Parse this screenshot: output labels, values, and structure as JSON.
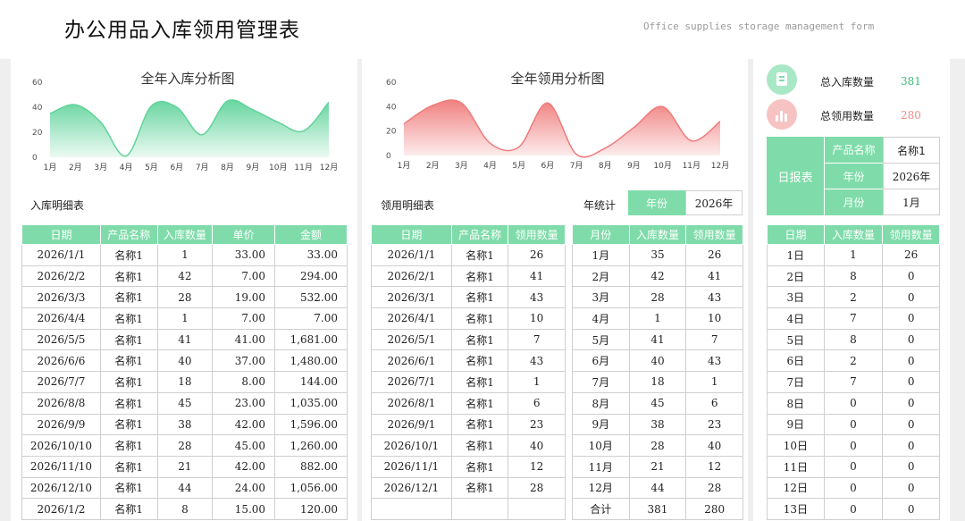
{
  "header": {
    "title": "办公用品入库领用管理表",
    "subtitle": "Office supplies storage management form"
  },
  "charts_labels": {
    "in_title": "全年入库分析图",
    "out_title": "全年领用分析图"
  },
  "chart_data": [
    {
      "type": "area",
      "title": "全年入库分析图",
      "categories": [
        "1月",
        "2月",
        "3月",
        "4月",
        "5月",
        "6月",
        "7月",
        "8月",
        "9月",
        "10月",
        "11月",
        "12月"
      ],
      "values": [
        35,
        42,
        28,
        1,
        41,
        40,
        18,
        45,
        38,
        28,
        21,
        44
      ],
      "ylim": [
        0,
        60
      ],
      "yticks": [
        0,
        20,
        40,
        60
      ],
      "color": "#5fd39a"
    },
    {
      "type": "area",
      "title": "全年领用分析图",
      "categories": [
        "1月",
        "2月",
        "3月",
        "4月",
        "5月",
        "6月",
        "7月",
        "8月",
        "9月",
        "10月",
        "11月",
        "12月"
      ],
      "values": [
        26,
        41,
        43,
        10,
        7,
        43,
        1,
        6,
        23,
        40,
        12,
        28
      ],
      "ylim": [
        0,
        60
      ],
      "yticks": [
        0,
        20,
        40,
        60
      ],
      "color": "#f07a7a"
    }
  ],
  "summary": {
    "in_label": "总入库数量",
    "in_value": "381",
    "out_label": "总领用数量",
    "out_value": "280"
  },
  "daily_report": {
    "label": "日报表",
    "rows": [
      {
        "k": "产品名称",
        "v": "名称1"
      },
      {
        "k": "年份",
        "v": "2026年"
      },
      {
        "k": "月份",
        "v": "1月"
      }
    ]
  },
  "year_stats": {
    "label": "年统计",
    "key": "年份",
    "value": "2026年"
  },
  "in_table": {
    "label": "入库明细表",
    "headers": [
      "日期",
      "产品名称",
      "入库数量",
      "单价",
      "金额"
    ],
    "rows": [
      [
        "2026/1/1",
        "名称1",
        "1",
        "33.00",
        "33.00"
      ],
      [
        "2026/2/2",
        "名称1",
        "42",
        "7.00",
        "294.00"
      ],
      [
        "2026/3/3",
        "名称1",
        "28",
        "19.00",
        "532.00"
      ],
      [
        "2026/4/4",
        "名称1",
        "1",
        "7.00",
        "7.00"
      ],
      [
        "2026/5/5",
        "名称1",
        "41",
        "41.00",
        "1,681.00"
      ],
      [
        "2026/6/6",
        "名称1",
        "40",
        "37.00",
        "1,480.00"
      ],
      [
        "2026/7/7",
        "名称1",
        "18",
        "8.00",
        "144.00"
      ],
      [
        "2026/8/8",
        "名称1",
        "45",
        "23.00",
        "1,035.00"
      ],
      [
        "2026/9/9",
        "名称1",
        "38",
        "42.00",
        "1,596.00"
      ],
      [
        "2026/10/10",
        "名称1",
        "28",
        "45.00",
        "1,260.00"
      ],
      [
        "2026/11/10",
        "名称1",
        "21",
        "42.00",
        "882.00"
      ],
      [
        "2026/12/10",
        "名称1",
        "44",
        "24.00",
        "1,056.00"
      ],
      [
        "2026/1/2",
        "名称1",
        "8",
        "15.00",
        "120.00"
      ]
    ]
  },
  "out_table": {
    "label": "领用明细表",
    "headers": [
      "日期",
      "产品名称",
      "领用数量"
    ],
    "rows": [
      [
        "2026/1/1",
        "名称1",
        "26"
      ],
      [
        "2026/2/1",
        "名称1",
        "41"
      ],
      [
        "2026/3/1",
        "名称1",
        "43"
      ],
      [
        "2026/4/1",
        "名称1",
        "10"
      ],
      [
        "2026/5/1",
        "名称1",
        "7"
      ],
      [
        "2026/6/1",
        "名称1",
        "43"
      ],
      [
        "2026/7/1",
        "名称1",
        "1"
      ],
      [
        "2026/8/1",
        "名称1",
        "6"
      ],
      [
        "2026/9/1",
        "名称1",
        "23"
      ],
      [
        "2026/10/1",
        "名称1",
        "40"
      ],
      [
        "2026/11/1",
        "名称1",
        "12"
      ],
      [
        "2026/12/1",
        "名称1",
        "28"
      ],
      [
        "",
        "",
        ""
      ]
    ]
  },
  "month_table": {
    "headers": [
      "月份",
      "入库数量",
      "领用数量"
    ],
    "rows": [
      [
        "1月",
        "35",
        "26"
      ],
      [
        "2月",
        "42",
        "41"
      ],
      [
        "3月",
        "28",
        "43"
      ],
      [
        "4月",
        "1",
        "10"
      ],
      [
        "5月",
        "41",
        "7"
      ],
      [
        "6月",
        "40",
        "43"
      ],
      [
        "7月",
        "18",
        "1"
      ],
      [
        "8月",
        "45",
        "6"
      ],
      [
        "9月",
        "38",
        "23"
      ],
      [
        "10月",
        "28",
        "40"
      ],
      [
        "11月",
        "21",
        "12"
      ],
      [
        "12月",
        "44",
        "28"
      ],
      [
        "合计",
        "381",
        "280"
      ]
    ]
  },
  "day_table": {
    "headers": [
      "日期",
      "入库数量",
      "领用数量"
    ],
    "rows": [
      [
        "1日",
        "1",
        "26"
      ],
      [
        "2日",
        "8",
        "0"
      ],
      [
        "3日",
        "2",
        "0"
      ],
      [
        "4日",
        "7",
        "0"
      ],
      [
        "5日",
        "8",
        "0"
      ],
      [
        "6日",
        "2",
        "0"
      ],
      [
        "7日",
        "7",
        "0"
      ],
      [
        "8日",
        "0",
        "0"
      ],
      [
        "9日",
        "0",
        "0"
      ],
      [
        "10日",
        "0",
        "0"
      ],
      [
        "11日",
        "0",
        "0"
      ],
      [
        "12日",
        "0",
        "0"
      ],
      [
        "13日",
        "0",
        "0"
      ]
    ]
  },
  "colors": {
    "green": "#7fdcaa",
    "green_text": "#3dbb7a",
    "red_text": "#f08a8a"
  }
}
